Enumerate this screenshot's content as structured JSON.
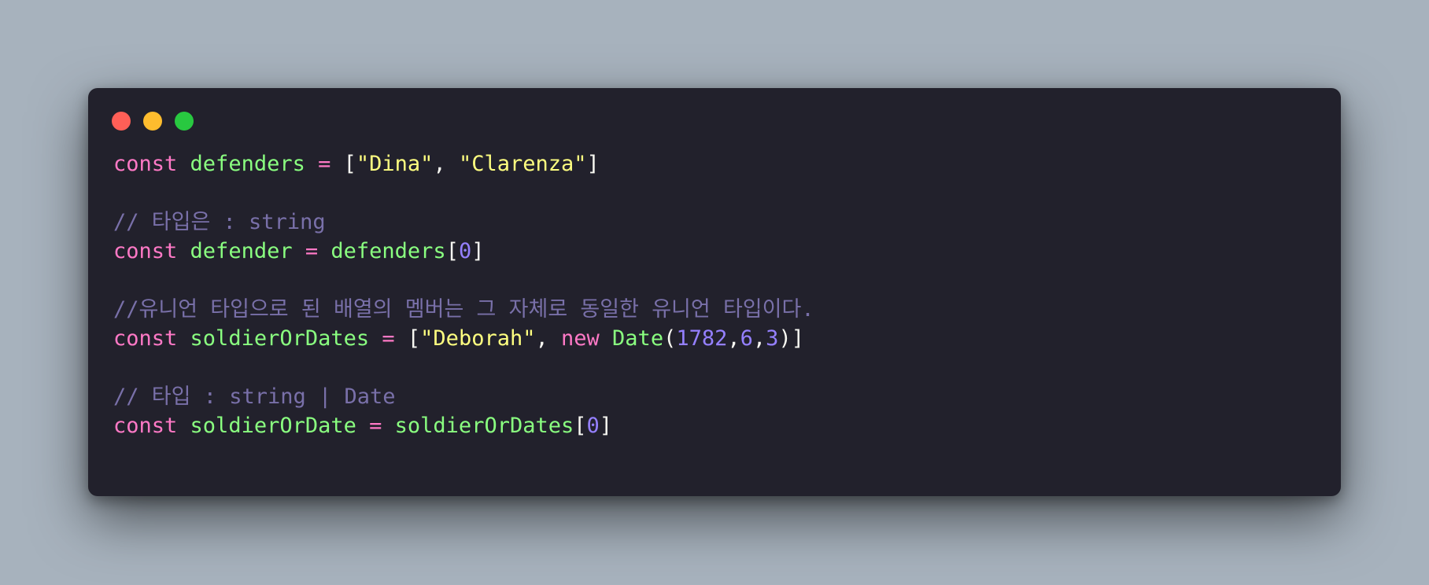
{
  "window": {
    "controls": [
      "close",
      "minimize",
      "maximize"
    ],
    "background": "#22212c"
  },
  "colors": {
    "keyword": "#ff79c6",
    "identifier": "#8aff80",
    "string": "#ffff80",
    "number": "#9580ff",
    "comment": "#7970a9",
    "punctuation": "#f8f8f2"
  },
  "code": {
    "line1": {
      "kw": "const",
      "name": "defenders",
      "op": " = ",
      "open": "[",
      "s1": "\"Dina\"",
      "comma": ", ",
      "s2": "\"Clarenza\"",
      "close": "]"
    },
    "line2": {
      "comment": "// 타입은 : string"
    },
    "line3": {
      "kw": "const",
      "name": "defender",
      "op": " = ",
      "ref": "defenders",
      "open": "[",
      "index": "0",
      "close": "]"
    },
    "line4": {
      "comment": "//유니언 타입으로 된 배열의 멤버는 그 자체로 동일한 유니언 타입이다."
    },
    "line5": {
      "kw": "const",
      "name": "soldierOrDates",
      "op": " = ",
      "open": "[",
      "s1": "\"Deborah\"",
      "comma": ", ",
      "new_kw": "new",
      "cls": "Date",
      "paren_open": "(",
      "n1": "1782",
      "c1": ",",
      "n2": "6",
      "c2": ",",
      "n3": "3",
      "paren_close": ")",
      "close": "]"
    },
    "line6": {
      "comment": "// 타입 : string | Date"
    },
    "line7": {
      "kw": "const",
      "name": "soldierOrDate",
      "op": " = ",
      "ref": "soldierOrDates",
      "open": "[",
      "index": "0",
      "close": "]"
    }
  }
}
